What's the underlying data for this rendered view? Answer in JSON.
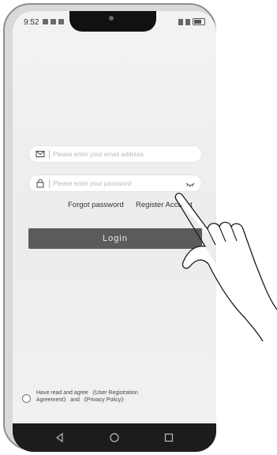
{
  "status_bar": {
    "time": "9:52"
  },
  "email_field": {
    "placeholder": "Please enter your email address"
  },
  "password_field": {
    "placeholder": "Please enter your password"
  },
  "links": {
    "forgot": "Forgot password",
    "register": "Register Account"
  },
  "login": {
    "label": "Login"
  },
  "agreement": {
    "line1": "Have read and agree  《User Registration",
    "line2": "Agreement》 and 《Privacy Policy》"
  },
  "colors": {
    "button_bg": "#5b5b5b",
    "nav_bar": "#1c1c1c",
    "screen_bg": "#f0f0f0"
  },
  "icons": [
    "mail-icon",
    "lock-icon",
    "eye-icon",
    "back-icon",
    "home-icon",
    "recent-apps-icon",
    "battery-icon"
  ]
}
